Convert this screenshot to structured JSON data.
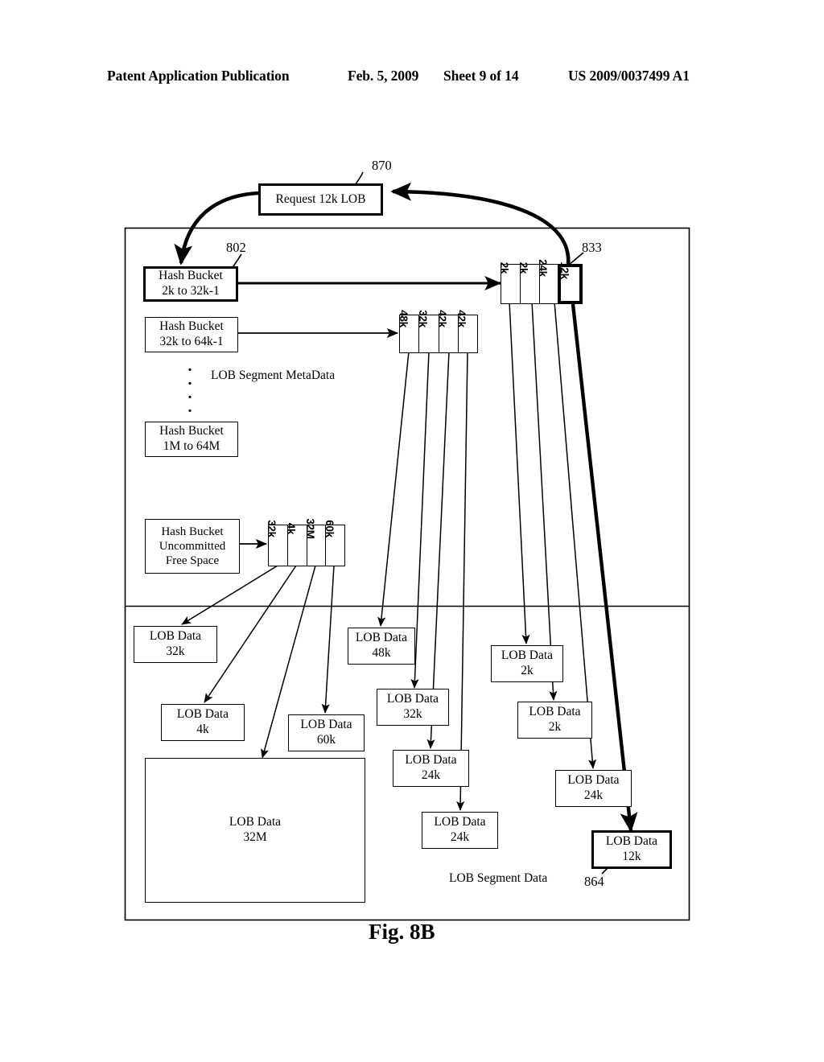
{
  "header": {
    "publication": "Patent Application Publication",
    "date": "Feb. 5, 2009",
    "sheet": "Sheet 9 of 14",
    "patent_number": "US 2009/0037499 A1"
  },
  "figure": {
    "caption": "Fig. 8B",
    "request_box": {
      "label": "Request 12k LOB",
      "ref": "870"
    },
    "metadata_section": {
      "title": "LOB Segment MetaData",
      "hash_buckets": [
        {
          "line1": "Hash Bucket",
          "line2": "2k to 32k-1",
          "ref": "802"
        },
        {
          "line1": "Hash Bucket",
          "line2": "32k to 64k-1"
        },
        {
          "line1": "Hash Bucket",
          "line2": "1M to 64M"
        }
      ],
      "free_space_bucket": {
        "line1": "Hash Bucket",
        "line2": "Uncommitted",
        "line3": "Free Space"
      },
      "cell_groups": [
        {
          "name": "bucket-2k-chain",
          "ref": "833",
          "cells": [
            {
              "label": "2k",
              "bold": false
            },
            {
              "label": "2k",
              "bold": false
            },
            {
              "label": "24k",
              "bold": false
            },
            {
              "label": "12k",
              "bold": true
            }
          ]
        },
        {
          "name": "bucket-32k-chain",
          "cells": [
            {
              "label": "48k",
              "bold": false
            },
            {
              "label": "32k",
              "bold": false
            },
            {
              "label": "42k",
              "bold": false
            },
            {
              "label": "42k",
              "bold": false
            }
          ]
        },
        {
          "name": "free-space-chain",
          "cells": [
            {
              "label": "32k",
              "bold": false
            },
            {
              "label": "4k",
              "bold": false
            },
            {
              "label": "32M",
              "bold": false
            },
            {
              "label": "60k",
              "bold": false
            }
          ]
        }
      ]
    },
    "data_section": {
      "title": "LOB Segment Data",
      "ref": "864",
      "blocks": [
        {
          "name": "lob-data-32k-a",
          "line1": "LOB Data",
          "line2": "32k",
          "bold": false
        },
        {
          "name": "lob-data-4k",
          "line1": "LOB Data",
          "line2": "4k",
          "bold": false
        },
        {
          "name": "lob-data-48k",
          "line1": "LOB Data",
          "line2": "48k",
          "bold": false
        },
        {
          "name": "lob-data-2k-a",
          "line1": "LOB Data",
          "line2": "2k",
          "bold": false
        },
        {
          "name": "lob-data-32k-b",
          "line1": "LOB Data",
          "line2": "32k",
          "bold": false
        },
        {
          "name": "lob-data-2k-b",
          "line1": "LOB Data",
          "line2": "2k",
          "bold": false
        },
        {
          "name": "lob-data-60k",
          "line1": "LOB Data",
          "line2": "60k",
          "bold": false
        },
        {
          "name": "lob-data-24k-a",
          "line1": "LOB Data",
          "line2": "24k",
          "bold": false
        },
        {
          "name": "lob-data-24k-b",
          "line1": "LOB Data",
          "line2": "24k",
          "bold": false
        },
        {
          "name": "lob-data-24k-c",
          "line1": "LOB Data",
          "line2": "24k",
          "bold": false
        },
        {
          "name": "lob-data-32M",
          "line1": "LOB Data",
          "line2": "32M",
          "bold": false
        },
        {
          "name": "lob-data-12k",
          "line1": "LOB Data",
          "line2": "12k",
          "bold": true
        }
      ]
    }
  }
}
